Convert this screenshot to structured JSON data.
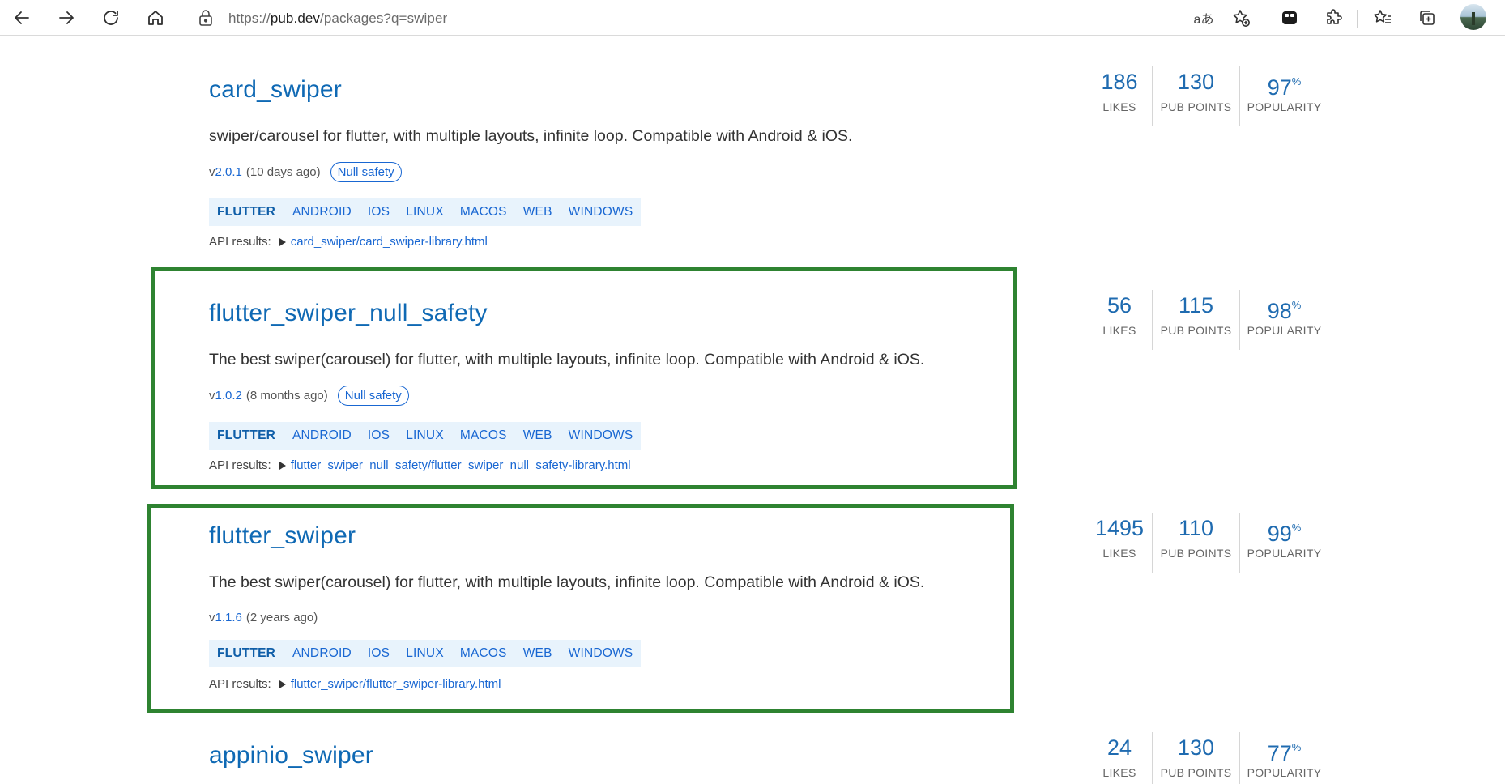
{
  "browser": {
    "url_prefix": "https://",
    "url_host": "pub.dev",
    "url_rest": "/packages?q=swiper",
    "read_aloud_label": "aあ"
  },
  "packages": [
    {
      "name": "card_swiper",
      "description": "swiper/carousel for flutter, with multiple layouts, infinite loop. Compatible with Android & iOS.",
      "version_prefix": "v ",
      "version": "2.0.1",
      "age": "(10 days ago)",
      "badge": "Null safety",
      "tags": [
        "FLUTTER",
        "ANDROID",
        "IOS",
        "LINUX",
        "MACOS",
        "WEB",
        "WINDOWS"
      ],
      "api_label": "API results:",
      "api_link": "card_swiper/card_swiper-library.html",
      "likes": "186",
      "pub_points": "130",
      "popularity": "97",
      "likes_label": "LIKES",
      "points_label": "PUB POINTS",
      "popularity_label": "POPULARITY",
      "percent": "%"
    },
    {
      "name": "flutter_swiper_null_safety",
      "description": "The best swiper(carousel) for flutter, with multiple layouts, infinite loop. Compatible with Android & iOS.",
      "version_prefix": "v ",
      "version": "1.0.2",
      "age": "(8 months ago)",
      "badge": "Null safety",
      "tags": [
        "FLUTTER",
        "ANDROID",
        "IOS",
        "LINUX",
        "MACOS",
        "WEB",
        "WINDOWS"
      ],
      "api_label": "API results:",
      "api_link": "flutter_swiper_null_safety/flutter_swiper_null_safety-library.html",
      "likes": "56",
      "pub_points": "115",
      "popularity": "98",
      "likes_label": "LIKES",
      "points_label": "PUB POINTS",
      "popularity_label": "POPULARITY",
      "percent": "%"
    },
    {
      "name": "flutter_swiper",
      "description": "The best swiper(carousel) for flutter, with multiple layouts, infinite loop. Compatible with Android & iOS.",
      "version_prefix": "v ",
      "version": "1.1.6",
      "age": "(2 years ago)",
      "tags": [
        "FLUTTER",
        "ANDROID",
        "IOS",
        "LINUX",
        "MACOS",
        "WEB",
        "WINDOWS"
      ],
      "api_label": "API results:",
      "api_link": "flutter_swiper/flutter_swiper-library.html",
      "likes": "1495",
      "pub_points": "110",
      "popularity": "99",
      "likes_label": "LIKES",
      "points_label": "PUB POINTS",
      "popularity_label": "POPULARITY",
      "percent": "%"
    },
    {
      "name": "appinio_swiper",
      "likes": "24",
      "pub_points": "130",
      "popularity": "77",
      "likes_label": "LIKES",
      "points_label": "PUB POINTS",
      "popularity_label": "POPULARITY",
      "percent": "%"
    }
  ],
  "highlight_color": "#2e8331"
}
